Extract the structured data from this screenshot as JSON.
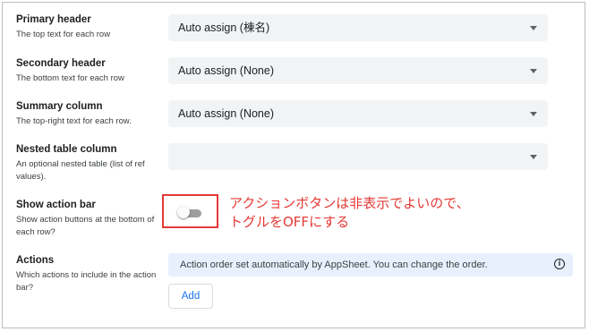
{
  "fields": [
    {
      "title": "Primary header",
      "description": "The top text for each row",
      "value": "Auto assign (棟名)"
    },
    {
      "title": "Secondary header",
      "description": "The bottom text for each row",
      "value": "Auto assign (None)"
    },
    {
      "title": "Summary column",
      "description": "The top-right text for each row.",
      "value": "Auto assign (None)"
    },
    {
      "title": "Nested table column",
      "description": "An optional nested table (list of ref values).",
      "value": ""
    }
  ],
  "action_bar": {
    "title": "Show action bar",
    "description": "Show action buttons at the bottom of each row?",
    "enabled": false
  },
  "annotation": {
    "text": "アクションボタンは非表示でよいので、\nトグルをOFFにする",
    "color": "#e53935"
  },
  "actions": {
    "title": "Actions",
    "description": "Which actions to include in the action bar?",
    "info_text": "Action order set automatically by AppSheet. You can change the order.",
    "info_icon": "info-icon",
    "add_label": "Add"
  },
  "colors": {
    "accent": "#1a73e8",
    "select_bg": "#f1f3f4",
    "banner_bg": "#e8f0fe",
    "highlight": "#e53935"
  }
}
